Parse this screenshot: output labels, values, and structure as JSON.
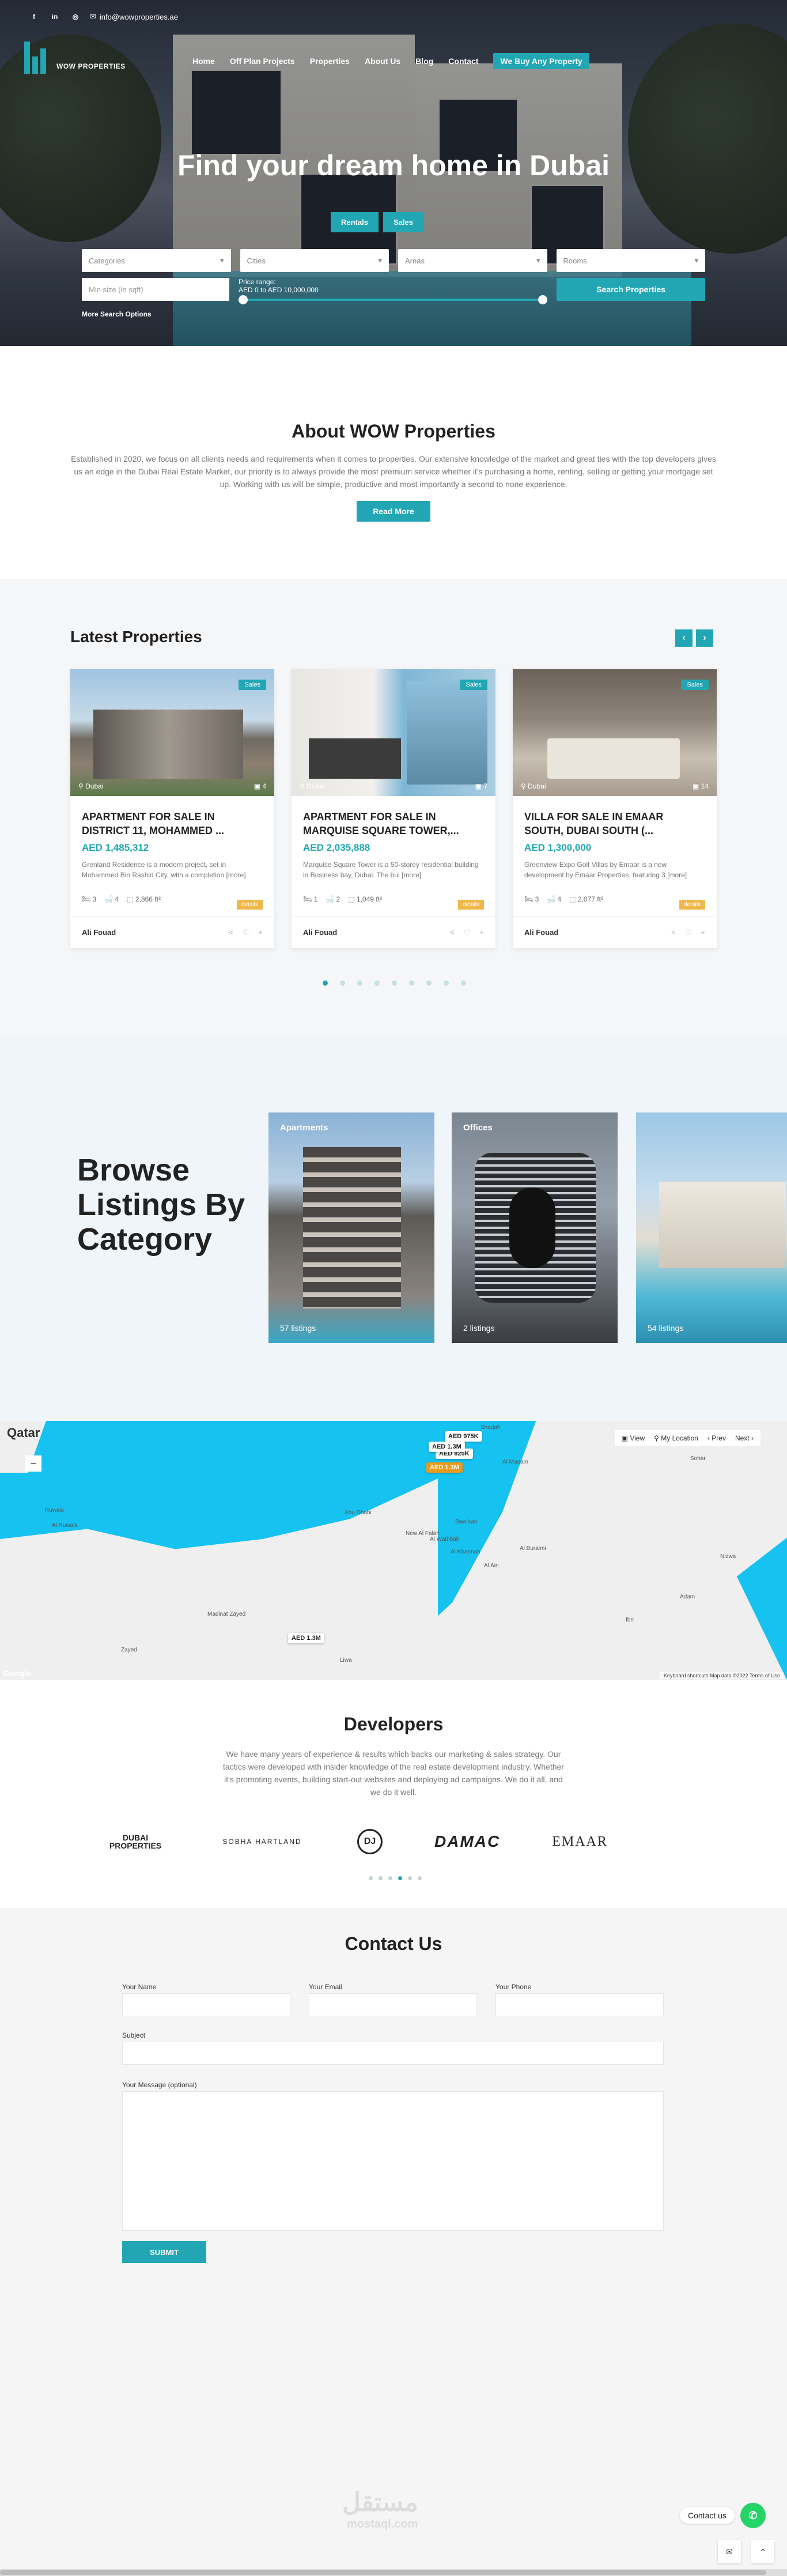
{
  "topbar": {
    "facebook": "f",
    "linkedin": "in",
    "instagram": "◎",
    "email": "info@wowproperties.ae"
  },
  "brand": {
    "name": "WOW PROPERTIES"
  },
  "nav": [
    {
      "label": "Home"
    },
    {
      "label": "Off Plan Projects"
    },
    {
      "label": "Properties"
    },
    {
      "label": "About Us"
    },
    {
      "label": "Blog"
    },
    {
      "label": "Contact"
    },
    {
      "label": "We Buy Any Property"
    }
  ],
  "hero": {
    "title": "Find your dream home in Dubai",
    "tab_rentals": "Rentals",
    "tab_sales": "Sales"
  },
  "search": {
    "categories": "Categories",
    "cities": "Cities",
    "areas": "Areas",
    "rooms": "Rooms",
    "min_size_placeholder": "Min size (in sqft)",
    "price_label": "Price range:",
    "price_value": "AED 0 to AED 10,000,000",
    "price_min": 0,
    "price_max": 10000000,
    "button": "Search Properties",
    "more": "More Search Options"
  },
  "about": {
    "title": "About WOW Properties",
    "text": "Established in 2020, we focus on all clients needs and requirements when it comes to properties. Our extensive knowledge of the market and great ties with the top developers gives us an edge in the Dubai Real Estate Market, our priority is to always provide the most premium service whether it's purchasing a home, renting, selling or getting your mortgage set up. Working with us will be simple, productive and most importantly a second to none experience.",
    "button": "Read More"
  },
  "latest": {
    "title": "Latest Properties",
    "prev": "‹",
    "next": "›",
    "cards": [
      {
        "badge": "Sales",
        "location": "Dubai",
        "photos": "4",
        "title": "APARTMENT FOR SALE IN DISTRICT 11, MOHAMMED ...",
        "price": "AED 1,485,312",
        "desc": "Grenland Residence is a modern project, set in Mohammed Bin Rashid City, with a completion [more]",
        "beds": "3",
        "baths": "4",
        "area": "2,866 ft²",
        "details": "details",
        "agent": "Ali Fouad"
      },
      {
        "badge": "Sales",
        "location": "Dubai",
        "photos": "7",
        "title": "APARTMENT FOR SALE IN MARQUISE SQUARE TOWER,...",
        "price": "AED 2,035,888",
        "desc": "Marquise Square Tower is a 50-storey residential building in Business bay, Dubai. The bui [more]",
        "beds": "1",
        "baths": "2",
        "area": "1,049 ft²",
        "details": "details",
        "agent": "Ali Fouad"
      },
      {
        "badge": "Sales",
        "location": "Dubai",
        "photos": "14",
        "title": "VILLA FOR SALE IN EMAAR SOUTH, DUBAI SOUTH (...",
        "price": "AED 1,300,000",
        "desc": "Greenview Expo Golf Villas by Emaar is a new development by Emaar Properties, featuring 3 [more]",
        "beds": "3",
        "baths": "4",
        "area": "2,077 ft²",
        "details": "details",
        "agent": "Ali Fouad"
      }
    ],
    "dots": 9,
    "active_dot": 0
  },
  "categories": {
    "title": "Browse Listings By Category",
    "tiles": [
      {
        "name": "Apartments",
        "count": "57 listings"
      },
      {
        "name": "Offices",
        "count": "2 listings"
      },
      {
        "name": "",
        "count": "54 listings"
      }
    ]
  },
  "map": {
    "view": "View",
    "my_location": "My Location",
    "prev": "Prev",
    "next": "Next",
    "region": "Qatar",
    "google": "Google",
    "attribution": "Keyboard shortcuts   Map data ©2022   Terms of Use",
    "pins": [
      "AED 975K",
      "AED 1.3M",
      "AED 825K",
      "AED 1.3M",
      "AED 1.3M"
    ],
    "places": [
      "Sharjah",
      "Al Madam",
      "Abu Dhabi",
      "Al Ain",
      "Al Buraimi",
      "Ibri",
      "Sohar",
      "Al Khatmah",
      "Ruwais",
      "Al Ruwais",
      "Zayed",
      "Liwa",
      "Madinat Zayed",
      "New Al Falah",
      "Al Wathbah",
      "Sweihan",
      "Nizwa",
      "Adam"
    ]
  },
  "developers": {
    "title": "Developers",
    "text": "We have many years of experience & results which backs our marketing & sales strategy. Our tactics were developed with insider knowledge of the real estate development industry. Whether it's promoting events, building start-out websites and deploying ad campaigns. We do it all, and we do it well.",
    "logos": [
      "DUBAI PROPERTIES",
      "SOBHA HARTLAND",
      "DJ",
      "DAMAC",
      "EMAAR"
    ],
    "dots": 6,
    "active_dot": 3
  },
  "contact": {
    "title": "Contact Us",
    "name": "Your Name",
    "email": "Your Email",
    "phone": "Your Phone",
    "subject": "Subject",
    "message": "Your Message (optional)",
    "submit": "SUBMIT",
    "whatsapp": "Contact us",
    "watermark": "مستقل",
    "watermark_en": "mostaql.com"
  }
}
